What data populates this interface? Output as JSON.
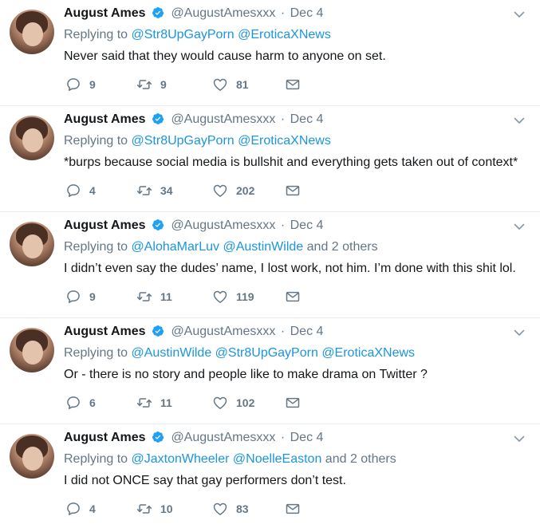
{
  "colors": {
    "link": "#1b95e0",
    "muted": "#657786",
    "verified": "#1da1f2"
  },
  "tweets": [
    {
      "name": "August Ames",
      "handle": "@AugustAmesxxx",
      "dot": "·",
      "date": "Dec 4",
      "replying_prefix": "Replying to",
      "mentions": [
        "@Str8UpGayPorn",
        "@EroticaXNews"
      ],
      "others": "",
      "text": "Never said that they would cause harm to anyone on set.",
      "replies": "9",
      "retweets": "9",
      "likes": "81"
    },
    {
      "name": "August Ames",
      "handle": "@AugustAmesxxx",
      "dot": "·",
      "date": "Dec 4",
      "replying_prefix": "Replying to",
      "mentions": [
        "@Str8UpGayPorn",
        "@EroticaXNews"
      ],
      "others": "",
      "text": "*burps because social media is bullshit and everything gets taken out of context*",
      "replies": "4",
      "retweets": "34",
      "likes": "202"
    },
    {
      "name": "August Ames",
      "handle": "@AugustAmesxxx",
      "dot": "·",
      "date": "Dec 4",
      "replying_prefix": "Replying to",
      "mentions": [
        "@AlohaMarLuv",
        "@AustinWilde"
      ],
      "others": "and 2 others",
      "text": "I didn’t even say the dudes’ name, I lost work, not him. I’m done with this shit lol.",
      "replies": "9",
      "retweets": "11",
      "likes": "119"
    },
    {
      "name": "August Ames",
      "handle": "@AugustAmesxxx",
      "dot": "·",
      "date": "Dec 4",
      "replying_prefix": "Replying to",
      "mentions": [
        "@AustinWilde",
        "@Str8UpGayPorn",
        "@EroticaXNews"
      ],
      "others": "",
      "text": "Or - there is no story and people like to make drama on Twitter ?",
      "replies": "6",
      "retweets": "11",
      "likes": "102"
    },
    {
      "name": "August Ames",
      "handle": "@AugustAmesxxx",
      "dot": "·",
      "date": "Dec 4",
      "replying_prefix": "Replying to",
      "mentions": [
        "@JaxtonWheeler",
        "@NoelleEaston"
      ],
      "others": "and 2 others",
      "text": "I did not ONCE say that gay performers don’t test.",
      "replies": "4",
      "retweets": "10",
      "likes": "83"
    }
  ]
}
